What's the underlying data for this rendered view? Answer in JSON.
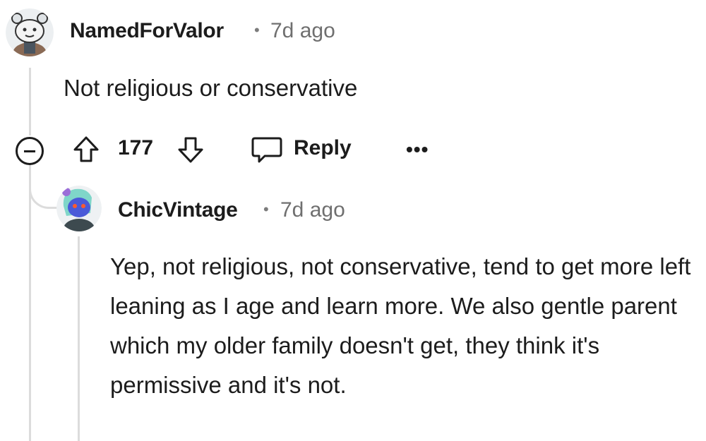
{
  "comment": {
    "author": "NamedForValor",
    "separator": "•",
    "time": "7d ago",
    "body": "Not religious or conservative",
    "actions": {
      "score": "177",
      "reply_label": "Reply",
      "more_label": "•••"
    }
  },
  "reply": {
    "author": "ChicVintage",
    "separator": "•",
    "time": "7d ago",
    "body": "Yep, not religious, not conservative, tend to get more left leaning as I age and learn more. We also gentle parent which my older family doesn't get, they think it's permissive and it's not."
  },
  "icons": [
    "collapse-icon",
    "upvote-icon",
    "downvote-icon",
    "reply-icon",
    "more-icon"
  ]
}
